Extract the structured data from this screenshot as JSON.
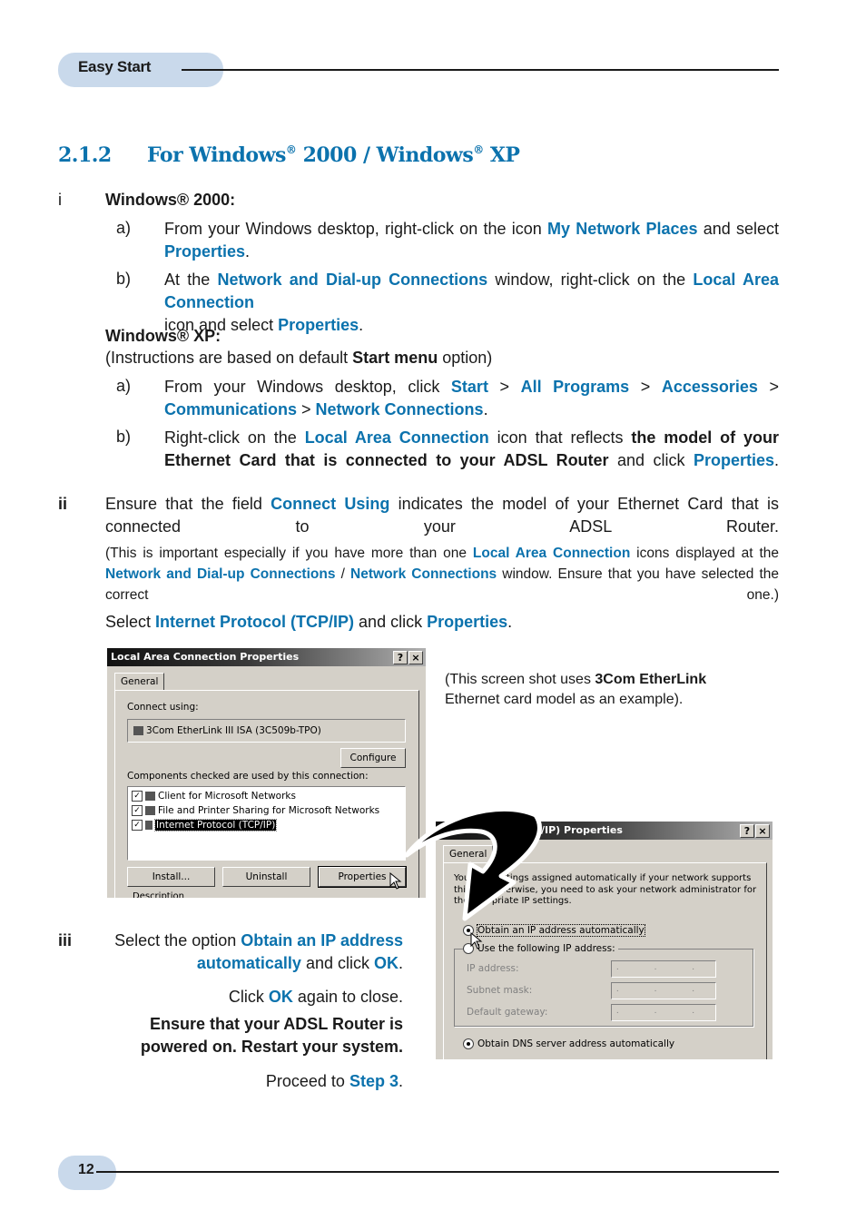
{
  "header": {
    "section_label": "Easy Start"
  },
  "footer": {
    "page_number": "12"
  },
  "title": {
    "number": "2.1.2",
    "part1": "For Windows",
    "reg": "®",
    "part2": " 2000 / Windows",
    "part3": " XP"
  },
  "step_i": {
    "marker": "i",
    "win2000": {
      "heading": "Windows® 2000:",
      "a": {
        "marker": "a)",
        "t1": "From your Windows desktop, right-click on the icon ",
        "l1": "My Network Places",
        "t2": " and select ",
        "l2": "Properties",
        "t3": "."
      },
      "b": {
        "marker": "b)",
        "t1": "At the ",
        "l1": "Network and Dial-up Connections",
        "t2": " window, right-click on the ",
        "l2": "Local Area Connection",
        "t3": " icon and select ",
        "l3": "Properties",
        "t4": "."
      }
    },
    "winxp": {
      "heading": "Windows® XP:",
      "note_t1": "(Instructions are based on default ",
      "note_b": "Start menu",
      "note_t2": " option)",
      "a": {
        "marker": "a)",
        "t1": "From your Windows desktop, click ",
        "l1": "Start",
        "s1": " > ",
        "l2": "All Programs",
        "s2": " > ",
        "l3": "Accessories",
        "s3": " > ",
        "l4": "Communications",
        "s4": " > ",
        "l5": "Network Connections",
        "t2": "."
      },
      "b": {
        "marker": "b)",
        "t1": "Right-click on the ",
        "l1": "Local Area Connection",
        "t2": " icon that reflects ",
        "b1": "the model of your Ethernet Card that is connected to your ADSL Router",
        "t3": " and click ",
        "l2": "Properties",
        "t4": "."
      }
    }
  },
  "step_ii": {
    "marker": "ii",
    "t1": "Ensure that the field ",
    "l1": "Connect Using",
    "t2": " indicates the model of your Ethernet Card that is connected to your ADSL Router.",
    "note": {
      "t1": "(This is important especially if you have more than one ",
      "l1": "Local Area Connection",
      "t2": " icons displayed at the ",
      "l2": "Network and Dial-up Connections",
      "s": " / ",
      "l3": "Network Connections",
      "t3": " window.  Ensure that you have selected the correct one.)"
    },
    "select": {
      "t1": "Select ",
      "l1": "Internet Protocol (TCP/IP)",
      "t2": " and click ",
      "l2": "Properties",
      "t3": "."
    }
  },
  "screenshot_note": {
    "t1": "(This screen shot uses ",
    "b1": "3Com EtherLink",
    "t2": " Ethernet card model as an example)."
  },
  "dialog1": {
    "title": "Local Area Connection Properties",
    "help_btn": "?",
    "close_btn": "×",
    "tab": "General",
    "connect_using_label": "Connect using:",
    "adapter": "3Com EtherLink III ISA (3C509b-TPO)",
    "configure_btn": "Configure",
    "components_label": "Components checked are used by this connection:",
    "components": [
      {
        "label": "Client for Microsoft Networks",
        "checked": true,
        "selected": false
      },
      {
        "label": "File and Printer Sharing for Microsoft Networks",
        "checked": true,
        "selected": false
      },
      {
        "label": "Internet Protocol (TCP/IP)",
        "checked": true,
        "selected": true
      }
    ],
    "install_btn": "Install...",
    "uninstall_btn": "Uninstall",
    "properties_btn": "Properties",
    "description_label": "Description"
  },
  "dialog2": {
    "title": "/IP) Properties",
    "help_btn": "?",
    "close_btn": "×",
    "tab": "General",
    "intro_l1": "You        settings assigned automatically if your network supports",
    "intro_l2": "this       otherwise, you need to ask your network administrator for",
    "intro_l3": "the        priate IP settings.",
    "opt_auto_ip": "Obtain an IP address automatically",
    "opt_manual_ip": "Use the following IP address:",
    "ip_label": "IP address:",
    "subnet_label": "Subnet mask:",
    "gateway_label": "Default gateway:",
    "ip_placeholder": ". . .",
    "opt_auto_dns": "Obtain DNS server address automatically",
    "selected_ip_option": "auto",
    "selected_dns_option": "auto"
  },
  "step_iii": {
    "marker": "iii",
    "t1": "Select the option ",
    "l1": "Obtain an IP address automatically",
    "t2": " and click ",
    "l2": "OK",
    "t3": ".",
    "close": {
      "t1": "Click ",
      "l1": "OK",
      "t2": " again to close."
    },
    "ensure": "Ensure that your ADSL Router is powered on.  Restart your system.",
    "proceed": {
      "t1": "Proceed to ",
      "l1": "Step 3",
      "t2": "."
    }
  },
  "colors": {
    "accent": "#0b72ad",
    "pill": "#c9d9eb",
    "dialog_face": "#d4d0c8"
  }
}
